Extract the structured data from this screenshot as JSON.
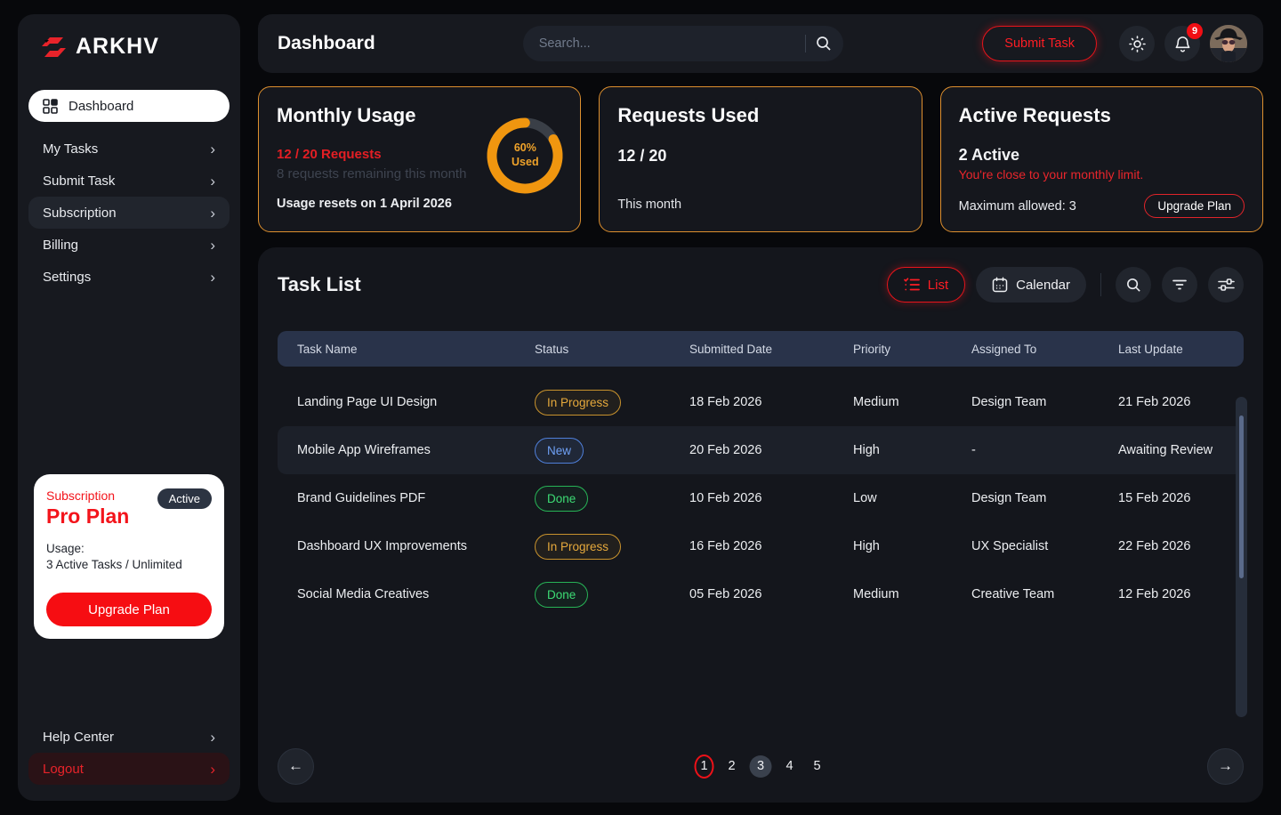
{
  "brand": {
    "name": "ARKHV"
  },
  "sidebar": {
    "active_item": {
      "label": "Dashboard"
    },
    "items": [
      {
        "label": "My Tasks"
      },
      {
        "label": "Submit Task"
      },
      {
        "label": "Subscription"
      },
      {
        "label": "Billing"
      },
      {
        "label": "Settings"
      }
    ],
    "subscription_card": {
      "eyebrow": "Subscription",
      "plan": "Pro Plan",
      "badge": "Active",
      "usage_label": "Usage:",
      "usage_value": "3 Active Tasks / Unlimited",
      "cta": "Upgrade Plan"
    },
    "footer_items": [
      {
        "label": "Help Center"
      },
      {
        "label": "Logout"
      }
    ]
  },
  "topbar": {
    "title": "Dashboard",
    "search_placeholder": "Search...",
    "submit_button": "Submit Task",
    "notification_count": "9"
  },
  "cards": {
    "monthly_usage": {
      "title": "Monthly Usage",
      "requests": "12 / 20 Requests",
      "remaining": "8 requests remaining this month",
      "reset": "Usage resets on 1 April 2026",
      "percent": "60%",
      "percent_sub": "Used"
    },
    "requests_used": {
      "title": "Requests Used",
      "value": "12 / 20",
      "caption": "This month"
    },
    "active_requests": {
      "title": "Active Requests",
      "value": "2 Active",
      "warning": "You're close to your monthly limit.",
      "max": "Maximum allowed: 3",
      "cta": "Upgrade Plan"
    }
  },
  "chart_data": {
    "type": "pie",
    "title": "Monthly Usage donut",
    "labels": [
      "Used",
      "Remaining"
    ],
    "values": [
      60,
      40
    ],
    "center_label": "60% Used",
    "colors": {
      "used": "#f0960f",
      "remaining": "#3a3f47"
    }
  },
  "task_list": {
    "title": "Task List",
    "views": {
      "list": "List",
      "calendar": "Calendar"
    },
    "columns": [
      "Task Name",
      "Status",
      "Submitted Date",
      "Priority",
      "Assigned To",
      "Last Update"
    ],
    "rows": [
      {
        "name": "Landing Page UI Design",
        "status": "In Progress",
        "status_type": "progress",
        "submitted": "18 Feb 2026",
        "priority": "Medium",
        "assigned": "Design Team",
        "updated": "21 Feb 2026"
      },
      {
        "name": "Mobile App Wireframes",
        "status": "New",
        "status_type": "new",
        "submitted": "20 Feb 2026",
        "priority": "High",
        "assigned": "-",
        "updated": "Awaiting Review"
      },
      {
        "name": "Brand Guidelines PDF",
        "status": "Done",
        "status_type": "done",
        "submitted": "10 Feb 2026",
        "priority": "Low",
        "assigned": "Design Team",
        "updated": "15 Feb 2026"
      },
      {
        "name": "Dashboard UX Improvements",
        "status": "In Progress",
        "status_type": "progress",
        "submitted": "16 Feb 2026",
        "priority": "High",
        "assigned": "UX Specialist",
        "updated": "22 Feb 2026"
      },
      {
        "name": "Social Media Creatives",
        "status": "Done",
        "status_type": "done",
        "submitted": "05 Feb 2026",
        "priority": "Medium",
        "assigned": "Creative Team",
        "updated": "12 Feb 2026"
      }
    ],
    "pagination": {
      "pages": [
        "1",
        "2",
        "3",
        "4",
        "5"
      ]
    }
  },
  "colors": {
    "accent_red": "#f01e23",
    "accent_orange": "#e2922e",
    "status_progress": "#e6a93c",
    "status_new": "#6fa0f5",
    "status_done": "#3ddc74"
  }
}
